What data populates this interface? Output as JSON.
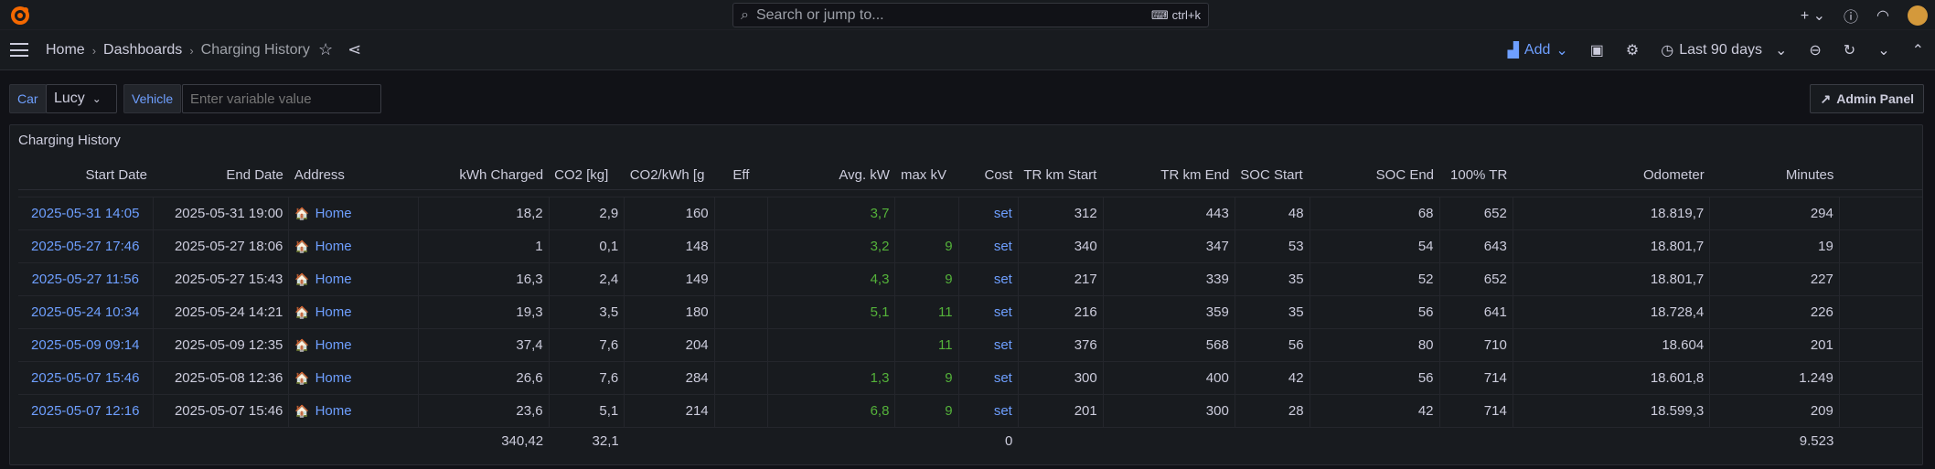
{
  "header": {
    "search_placeholder": "Search or jump to...",
    "shortcut": "ctrl+k",
    "breadcrumb": [
      "Home",
      "Dashboards",
      "Charging History"
    ],
    "add_label": "Add",
    "time_range": "Last 90 days"
  },
  "variables": {
    "car_label": "Car",
    "car_value": "Lucy",
    "vehicle_label": "Vehicle",
    "vehicle_placeholder": "Enter variable value",
    "admin_label": "Admin Panel"
  },
  "panel": {
    "title": "Charging History",
    "columns": [
      "Start Date",
      "End Date",
      "Address",
      "kWh Charged",
      "CO2 [kg]",
      "CO2/kWh [g",
      "Eff",
      "Avg. kW",
      "max kV",
      "Cost",
      "TR km Start",
      "TR km End",
      "SOC Start",
      "SOC End",
      "100% TR",
      "Odometer",
      "Minutes"
    ],
    "rows": [
      [
        "2025-05-31 14:05",
        "2025-05-31 19:00",
        "Home",
        "18,2",
        "2,9",
        "160",
        "",
        "3,7",
        "",
        "set",
        "312",
        "443",
        "48",
        "68",
        "652",
        "18.819,7",
        "294"
      ],
      [
        "2025-05-27 17:46",
        "2025-05-27 18:06",
        "Home",
        "1",
        "0,1",
        "148",
        "",
        "3,2",
        "9",
        "set",
        "340",
        "347",
        "53",
        "54",
        "643",
        "18.801,7",
        "19"
      ],
      [
        "2025-05-27 11:56",
        "2025-05-27 15:43",
        "Home",
        "16,3",
        "2,4",
        "149",
        "",
        "4,3",
        "9",
        "set",
        "217",
        "339",
        "35",
        "52",
        "652",
        "18.801,7",
        "227"
      ],
      [
        "2025-05-24 10:34",
        "2025-05-24 14:21",
        "Home",
        "19,3",
        "3,5",
        "180",
        "",
        "5,1",
        "11",
        "set",
        "216",
        "359",
        "35",
        "56",
        "641",
        "18.728,4",
        "226"
      ],
      [
        "2025-05-09 09:14",
        "2025-05-09 12:35",
        "Home",
        "37,4",
        "7,6",
        "204",
        "",
        "",
        "11",
        "set",
        "376",
        "568",
        "56",
        "80",
        "710",
        "18.604",
        "201"
      ],
      [
        "2025-05-07 15:46",
        "2025-05-08 12:36",
        "Home",
        "26,6",
        "7,6",
        "284",
        "",
        "1,3",
        "9",
        "set",
        "300",
        "400",
        "42",
        "56",
        "714",
        "18.601,8",
        "1.249"
      ],
      [
        "2025-05-07 12:16",
        "2025-05-07 15:46",
        "Home",
        "23,6",
        "5,1",
        "214",
        "",
        "6,8",
        "9",
        "set",
        "201",
        "300",
        "28",
        "42",
        "714",
        "18.599,3",
        "209"
      ]
    ],
    "footer": [
      "",
      "",
      "",
      "340,42",
      "32,1",
      "",
      "",
      "",
      "",
      "0",
      "",
      "",
      "",
      "",
      "",
      "",
      "9.523"
    ]
  }
}
